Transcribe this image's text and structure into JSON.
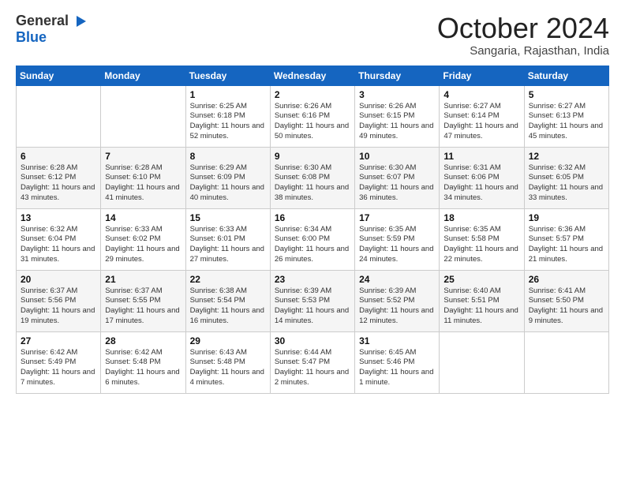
{
  "header": {
    "logo_general": "General",
    "logo_blue": "Blue",
    "month_title": "October 2024",
    "location": "Sangaria, Rajasthan, India"
  },
  "days_of_week": [
    "Sunday",
    "Monday",
    "Tuesday",
    "Wednesday",
    "Thursday",
    "Friday",
    "Saturday"
  ],
  "weeks": [
    [
      {
        "day": "",
        "info": ""
      },
      {
        "day": "",
        "info": ""
      },
      {
        "day": "1",
        "info": "Sunrise: 6:25 AM\nSunset: 6:18 PM\nDaylight: 11 hours and 52 minutes."
      },
      {
        "day": "2",
        "info": "Sunrise: 6:26 AM\nSunset: 6:16 PM\nDaylight: 11 hours and 50 minutes."
      },
      {
        "day": "3",
        "info": "Sunrise: 6:26 AM\nSunset: 6:15 PM\nDaylight: 11 hours and 49 minutes."
      },
      {
        "day": "4",
        "info": "Sunrise: 6:27 AM\nSunset: 6:14 PM\nDaylight: 11 hours and 47 minutes."
      },
      {
        "day": "5",
        "info": "Sunrise: 6:27 AM\nSunset: 6:13 PM\nDaylight: 11 hours and 45 minutes."
      }
    ],
    [
      {
        "day": "6",
        "info": "Sunrise: 6:28 AM\nSunset: 6:12 PM\nDaylight: 11 hours and 43 minutes."
      },
      {
        "day": "7",
        "info": "Sunrise: 6:28 AM\nSunset: 6:10 PM\nDaylight: 11 hours and 41 minutes."
      },
      {
        "day": "8",
        "info": "Sunrise: 6:29 AM\nSunset: 6:09 PM\nDaylight: 11 hours and 40 minutes."
      },
      {
        "day": "9",
        "info": "Sunrise: 6:30 AM\nSunset: 6:08 PM\nDaylight: 11 hours and 38 minutes."
      },
      {
        "day": "10",
        "info": "Sunrise: 6:30 AM\nSunset: 6:07 PM\nDaylight: 11 hours and 36 minutes."
      },
      {
        "day": "11",
        "info": "Sunrise: 6:31 AM\nSunset: 6:06 PM\nDaylight: 11 hours and 34 minutes."
      },
      {
        "day": "12",
        "info": "Sunrise: 6:32 AM\nSunset: 6:05 PM\nDaylight: 11 hours and 33 minutes."
      }
    ],
    [
      {
        "day": "13",
        "info": "Sunrise: 6:32 AM\nSunset: 6:04 PM\nDaylight: 11 hours and 31 minutes."
      },
      {
        "day": "14",
        "info": "Sunrise: 6:33 AM\nSunset: 6:02 PM\nDaylight: 11 hours and 29 minutes."
      },
      {
        "day": "15",
        "info": "Sunrise: 6:33 AM\nSunset: 6:01 PM\nDaylight: 11 hours and 27 minutes."
      },
      {
        "day": "16",
        "info": "Sunrise: 6:34 AM\nSunset: 6:00 PM\nDaylight: 11 hours and 26 minutes."
      },
      {
        "day": "17",
        "info": "Sunrise: 6:35 AM\nSunset: 5:59 PM\nDaylight: 11 hours and 24 minutes."
      },
      {
        "day": "18",
        "info": "Sunrise: 6:35 AM\nSunset: 5:58 PM\nDaylight: 11 hours and 22 minutes."
      },
      {
        "day": "19",
        "info": "Sunrise: 6:36 AM\nSunset: 5:57 PM\nDaylight: 11 hours and 21 minutes."
      }
    ],
    [
      {
        "day": "20",
        "info": "Sunrise: 6:37 AM\nSunset: 5:56 PM\nDaylight: 11 hours and 19 minutes."
      },
      {
        "day": "21",
        "info": "Sunrise: 6:37 AM\nSunset: 5:55 PM\nDaylight: 11 hours and 17 minutes."
      },
      {
        "day": "22",
        "info": "Sunrise: 6:38 AM\nSunset: 5:54 PM\nDaylight: 11 hours and 16 minutes."
      },
      {
        "day": "23",
        "info": "Sunrise: 6:39 AM\nSunset: 5:53 PM\nDaylight: 11 hours and 14 minutes."
      },
      {
        "day": "24",
        "info": "Sunrise: 6:39 AM\nSunset: 5:52 PM\nDaylight: 11 hours and 12 minutes."
      },
      {
        "day": "25",
        "info": "Sunrise: 6:40 AM\nSunset: 5:51 PM\nDaylight: 11 hours and 11 minutes."
      },
      {
        "day": "26",
        "info": "Sunrise: 6:41 AM\nSunset: 5:50 PM\nDaylight: 11 hours and 9 minutes."
      }
    ],
    [
      {
        "day": "27",
        "info": "Sunrise: 6:42 AM\nSunset: 5:49 PM\nDaylight: 11 hours and 7 minutes."
      },
      {
        "day": "28",
        "info": "Sunrise: 6:42 AM\nSunset: 5:48 PM\nDaylight: 11 hours and 6 minutes."
      },
      {
        "day": "29",
        "info": "Sunrise: 6:43 AM\nSunset: 5:48 PM\nDaylight: 11 hours and 4 minutes."
      },
      {
        "day": "30",
        "info": "Sunrise: 6:44 AM\nSunset: 5:47 PM\nDaylight: 11 hours and 2 minutes."
      },
      {
        "day": "31",
        "info": "Sunrise: 6:45 AM\nSunset: 5:46 PM\nDaylight: 11 hours and 1 minute."
      },
      {
        "day": "",
        "info": ""
      },
      {
        "day": "",
        "info": ""
      }
    ]
  ]
}
